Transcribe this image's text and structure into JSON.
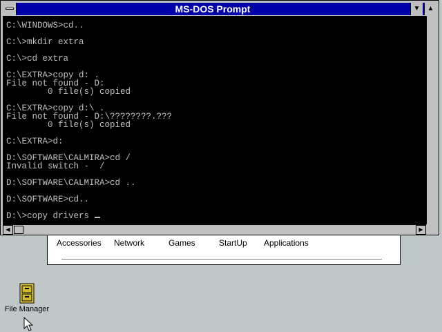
{
  "window": {
    "title": "MS-DOS Prompt"
  },
  "console": {
    "lines": [
      "C:\\WINDOWS>cd..",
      "",
      "C:\\>mkdir extra",
      "",
      "C:\\>cd extra",
      "",
      "C:\\EXTRA>copy d: .",
      "File not found - D:",
      "        0 file(s) copied",
      "",
      "C:\\EXTRA>copy d:\\ .",
      "File not found - D:\\????????.???",
      "        0 file(s) copied",
      "",
      "C:\\EXTRA>d:",
      "",
      "D:\\SOFTWARE\\CALMIRA>cd /",
      "Invalid switch -  /",
      "",
      "D:\\SOFTWARE\\CALMIRA>cd ..",
      "",
      "D:\\SOFTWARE>cd..",
      "",
      "D:\\>copy drivers "
    ]
  },
  "program_group": {
    "items": [
      "Accessories",
      "Network",
      "Games",
      "StartUp",
      "Applications"
    ]
  },
  "desktop": {
    "icons": [
      {
        "label": "File Manager",
        "icon": "file-cabinet-icon"
      }
    ]
  },
  "colors": {
    "titlebar": "#0000a8",
    "console_bg": "#000000",
    "console_text": "#c0c0c0",
    "desktop": "#c0c7c8"
  }
}
